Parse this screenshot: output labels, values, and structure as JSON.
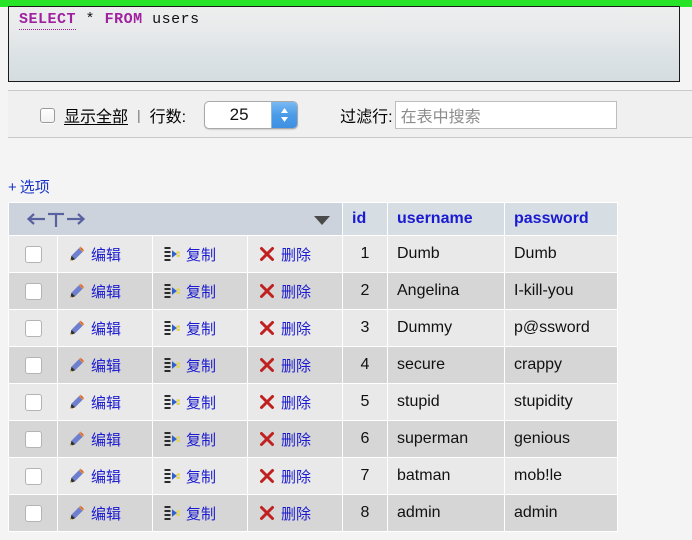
{
  "accent": {
    "green_bar": "#28e428",
    "link_blue": "#1a1ad0",
    "header_blue": "#1a1ad0",
    "keyword_purple": "#a020a0",
    "stepper_blue": "#4a9be8"
  },
  "query": {
    "keyword1": "SELECT",
    "star": "*",
    "keyword2": "FROM",
    "table": "users"
  },
  "controls": {
    "show_all_label": "显示全部",
    "separator": "|",
    "rows_label": "行数:",
    "rows_value": "25",
    "rows_options": [
      "25"
    ],
    "filter_label": "过滤行:",
    "filter_value": "",
    "filter_placeholder": "在表中搜索"
  },
  "options": {
    "plus": "+",
    "label": "选项"
  },
  "table": {
    "nav_hint": "←T→",
    "actions": {
      "edit": "编辑",
      "copy": "复制",
      "delete": "删除"
    },
    "columns": [
      "id",
      "username",
      "password"
    ],
    "rows": [
      {
        "id": "1",
        "username": "Dumb",
        "password": "Dumb"
      },
      {
        "id": "2",
        "username": "Angelina",
        "password": "I-kill-you"
      },
      {
        "id": "3",
        "username": "Dummy",
        "password": "p@ssword"
      },
      {
        "id": "4",
        "username": "secure",
        "password": "crappy"
      },
      {
        "id": "5",
        "username": "stupid",
        "password": "stupidity"
      },
      {
        "id": "6",
        "username": "superman",
        "password": "genious"
      },
      {
        "id": "7",
        "username": "batman",
        "password": "mob!le"
      },
      {
        "id": "8",
        "username": "admin",
        "password": "admin"
      }
    ]
  }
}
